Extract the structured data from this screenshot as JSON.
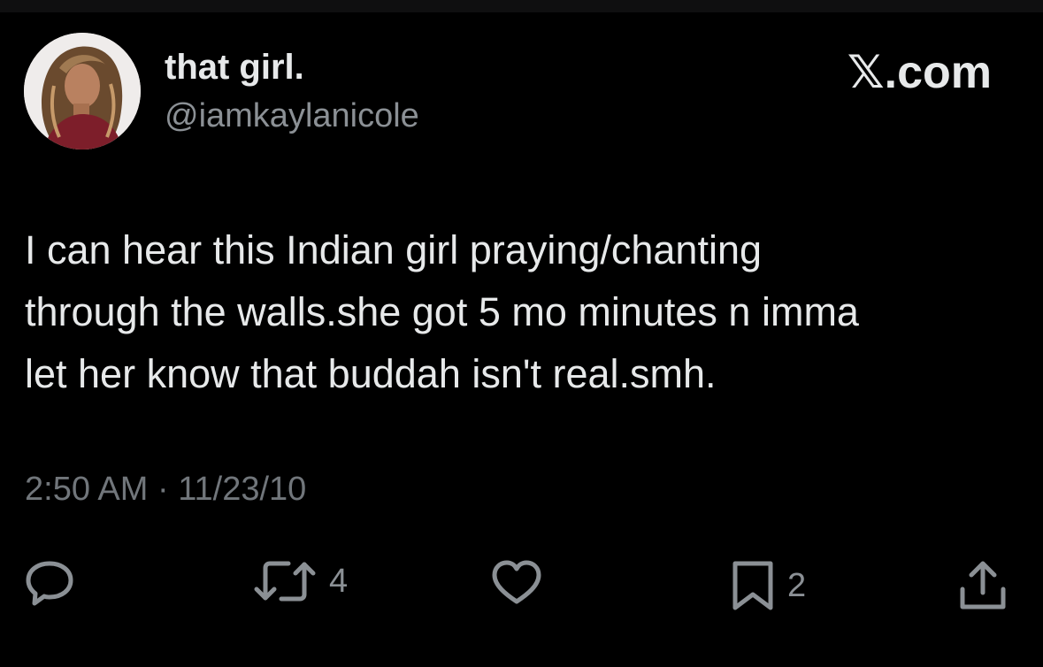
{
  "user": {
    "display_name": "that girl.",
    "handle": "@iamkaylanicole",
    "avatar_icon": "profile-photo"
  },
  "brand": {
    "label": "𝕏.com"
  },
  "tweet": {
    "lines": [
      "I can hear this Indian girl praying/chanting",
      "through the walls.she got 5 mo minutes n imma",
      "let her know that buddah isn't real.smh."
    ],
    "time": "2:50 AM",
    "separator": "·",
    "date": "11/23/10"
  },
  "actions": {
    "reply": {
      "icon": "reply-icon",
      "count": ""
    },
    "retweet": {
      "icon": "retweet-icon",
      "count": "4"
    },
    "like": {
      "icon": "heart-icon",
      "count": ""
    },
    "bookmark": {
      "icon": "bookmark-icon",
      "count": "2"
    },
    "share": {
      "icon": "share-icon"
    }
  },
  "colors": {
    "background": "#000000",
    "text": "#e7e9ea",
    "secondary": "#71767b",
    "icon": "#8b9095"
  }
}
